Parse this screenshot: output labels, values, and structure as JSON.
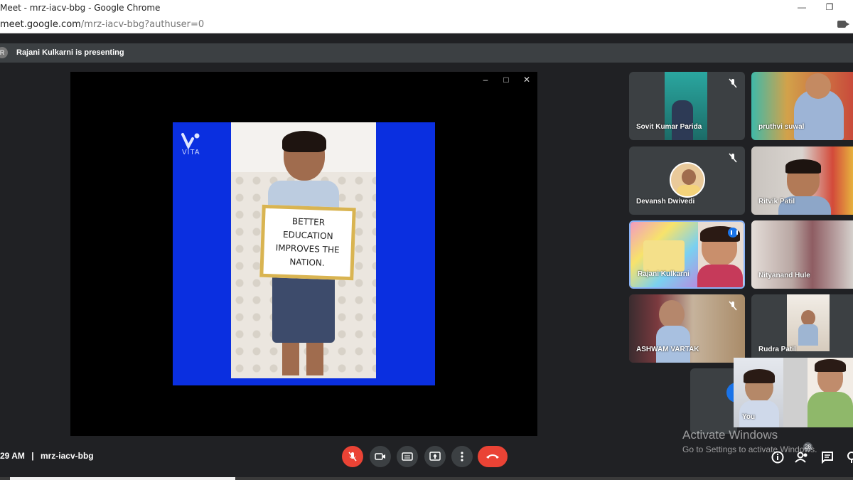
{
  "browser": {
    "title": "Meet - mrz-iacv-bbg - Google Chrome",
    "url_host": "meet.google.com",
    "url_path": "/mrz-iacv-bbg?authuser=0"
  },
  "presenting": {
    "avatar_letter": "R",
    "text": "Rajani Kulkarni is presenting"
  },
  "slide": {
    "brand": "VITA",
    "sign_text": "BETTER\nEDUCATION\nIMPROVES THE\nNATION.",
    "colors": {
      "background": "#0a2fe0",
      "sign_border": "#d9b451"
    }
  },
  "participants": [
    {
      "name": "Sovit Kumar Parida",
      "muted": true
    },
    {
      "name": "pruthvi suwal",
      "muted": false
    },
    {
      "name": "Devansh Dwivedi",
      "muted": true
    },
    {
      "name": "Ritvik Patil",
      "muted": false
    },
    {
      "name": "Rajani Kulkarni",
      "muted": false,
      "speaking": true
    },
    {
      "name": "Nityanand Hule",
      "muted": false
    },
    {
      "name": "ASHWAM VARTAK",
      "muted": true
    },
    {
      "name": "Rudra Patil",
      "muted": false
    }
  ],
  "self_tile": {
    "name": "You"
  },
  "meeting": {
    "time": "29 AM",
    "separator": "|",
    "code": "mrz-iacv-bbg"
  },
  "controls": {
    "icons": [
      "mic-off-icon",
      "camera-icon",
      "captions-icon",
      "present-icon",
      "more-options-icon",
      "leave-call-icon"
    ],
    "people_count": "28"
  },
  "watermark": {
    "line1": "Activate Windows",
    "line2": "Go to Settings to activate Windows."
  }
}
